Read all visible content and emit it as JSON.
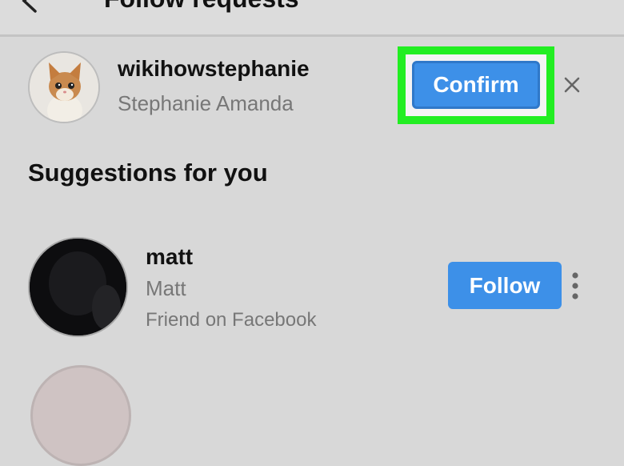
{
  "header": {
    "title": "Follow requests"
  },
  "request": {
    "username": "wikihowstephanie",
    "fullname": "Stephanie Amanda",
    "confirm_label": "Confirm"
  },
  "suggestions": {
    "title": "Suggestions for you",
    "items": [
      {
        "username": "matt",
        "fullname": "Matt",
        "subtext": "Friend on Facebook",
        "follow_label": "Follow"
      }
    ]
  },
  "colors": {
    "accent": "#3d90e8",
    "highlight": "#22ee22",
    "background": "#d8d8d8"
  },
  "icons": {
    "back": "back-arrow-icon",
    "close": "close-icon",
    "more": "more-vertical-icon"
  }
}
